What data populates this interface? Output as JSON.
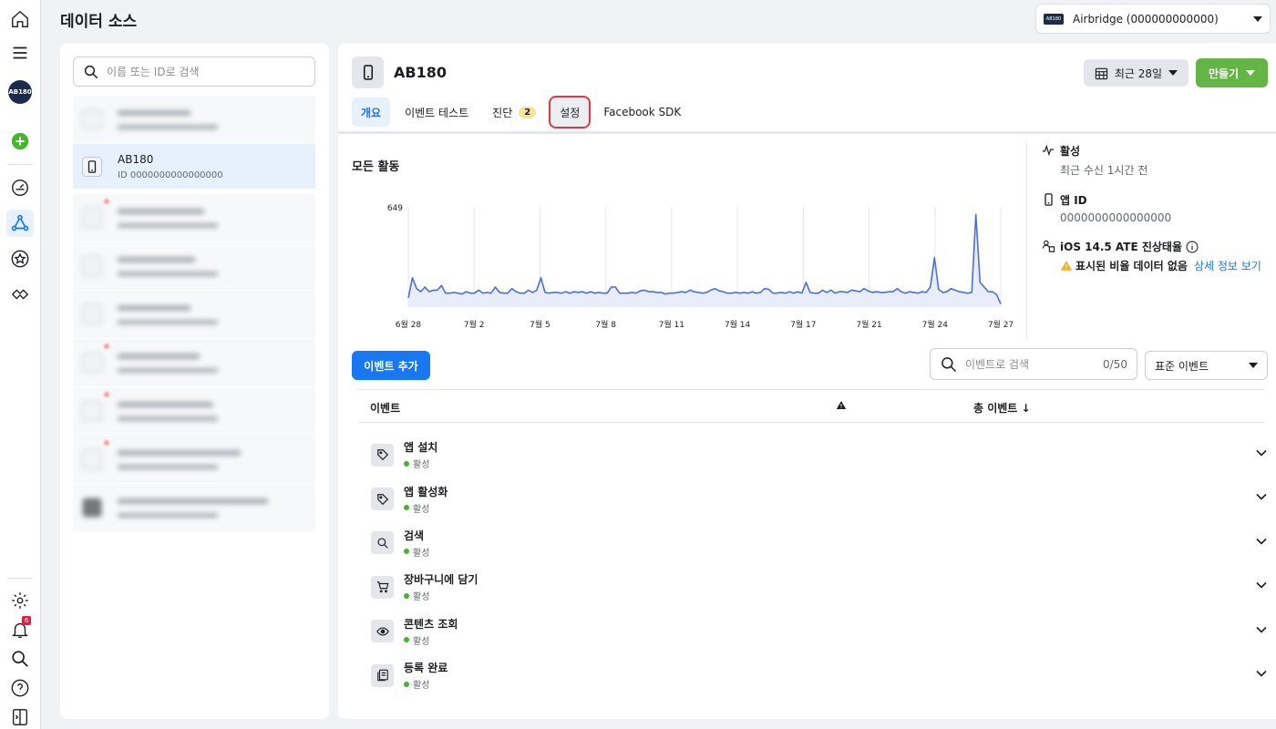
{
  "page": {
    "title": "데이터 소스"
  },
  "account": {
    "name": "Airbridge (000000000000)",
    "logo": "AB180"
  },
  "rail": {
    "logo": "AB180",
    "notification_count": "6"
  },
  "sources": {
    "search_placeholder": "이름 또는 ID로 검색",
    "selected": {
      "name": "AB180",
      "id": "ID 0000000000000000"
    }
  },
  "app": {
    "title": "AB180"
  },
  "toolbar": {
    "date_label": "최근 28일",
    "create_label": "만들기"
  },
  "tabs": [
    {
      "label": "개요"
    },
    {
      "label": "이벤트 테스트"
    },
    {
      "label": "진단",
      "badge": "2"
    },
    {
      "label": "설정"
    },
    {
      "label": "Facebook SDK"
    }
  ],
  "chart_data": {
    "type": "area",
    "title": "모든 활동",
    "ymax_label": "649",
    "x_ticks": [
      "6월 28",
      "7월 2",
      "7월 5",
      "7월 8",
      "7월 11",
      "7월 14",
      "7월 17",
      "7월 21",
      "7월 24",
      "7월 27"
    ],
    "ylim": [
      0,
      649
    ],
    "values": [
      60,
      190,
      120,
      100,
      130,
      100,
      110,
      110,
      140,
      90,
      90,
      95,
      90,
      85,
      100,
      90,
      90,
      110,
      90,
      95,
      90,
      130,
      95,
      90,
      90,
      120,
      100,
      90,
      90,
      110,
      95,
      110,
      190,
      95,
      90,
      95,
      95,
      90,
      100,
      90,
      100,
      95,
      100,
      90,
      100,
      90,
      95,
      90,
      90,
      130,
      130,
      90,
      90,
      90,
      95,
      90,
      105,
      110,
      100,
      100,
      95,
      95,
      85,
      90,
      90,
      95,
      100,
      95,
      110,
      100,
      95,
      90,
      95,
      110,
      120,
      105,
      100,
      90,
      90,
      95,
      90,
      95,
      90,
      100,
      90,
      95,
      120,
      115,
      90,
      90,
      95,
      90,
      100,
      90,
      100,
      90,
      160,
      95,
      90,
      90,
      110,
      95,
      110,
      90,
      100,
      100,
      95,
      110,
      105,
      100,
      120,
      105,
      95,
      100,
      95,
      95,
      100,
      100,
      120,
      100,
      90,
      100,
      95,
      90,
      100,
      95,
      130,
      320,
      115,
      95,
      100,
      120,
      110,
      100,
      95,
      90,
      95,
      600,
      160,
      130,
      100,
      100,
      80,
      20
    ],
    "color": "#4c6fdc"
  },
  "info": {
    "status": {
      "title": "활성",
      "value": "최근 수신 1시간 전"
    },
    "app_id": {
      "title": "앱 ID",
      "value": "0000000000000000"
    },
    "ios": {
      "title": "iOS 14.5 ATE 진상태율",
      "warning": "표시된 비율 데이터 없음",
      "link": "상세 정보 보기"
    }
  },
  "events": {
    "add_label": "이벤트 추가",
    "search_placeholder": "이벤트로 검색",
    "count": "0/50",
    "filter": "표준 이벤트",
    "col_event": "이벤트",
    "col_total": "총 이벤트 ↓",
    "rows": [
      {
        "name": "앱 설치",
        "status": "활성",
        "icon": "tag-icon"
      },
      {
        "name": "앱 활성화",
        "status": "활성",
        "icon": "tag-icon"
      },
      {
        "name": "검색",
        "status": "활성",
        "icon": "search-icon"
      },
      {
        "name": "장바구니에 담기",
        "status": "활성",
        "icon": "cart-icon"
      },
      {
        "name": "콘텐츠 조회",
        "status": "활성",
        "icon": "eye-icon"
      },
      {
        "name": "등록 완료",
        "status": "활성",
        "icon": "registration-icon"
      }
    ]
  }
}
